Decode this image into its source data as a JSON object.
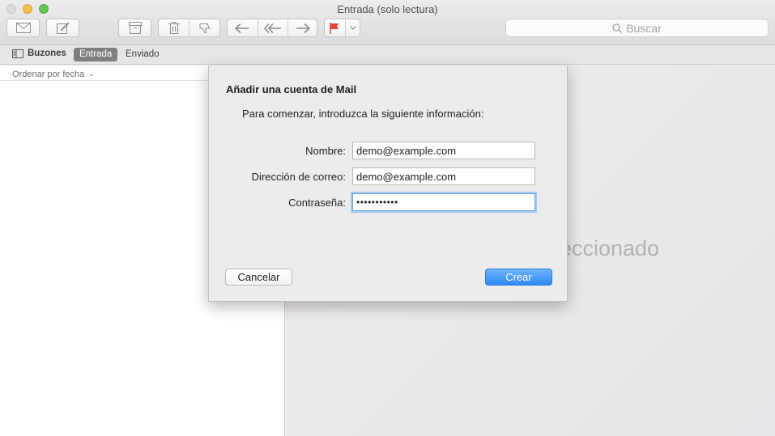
{
  "window": {
    "title": "Entrada (solo lectura)"
  },
  "toolbar": {
    "buttons": [
      {
        "name": "get-mail",
        "icon": "envelope-icon"
      },
      {
        "name": "compose",
        "icon": "compose-icon"
      },
      {
        "name": "archive",
        "icon": "archive-icon"
      },
      {
        "name": "delete",
        "icon": "trash-icon"
      },
      {
        "name": "junk",
        "icon": "thumbs-down-icon"
      },
      {
        "name": "reply",
        "icon": "reply-icon"
      },
      {
        "name": "reply-all",
        "icon": "reply-all-icon"
      },
      {
        "name": "forward",
        "icon": "forward-icon"
      },
      {
        "name": "flag",
        "icon": "flag-icon"
      },
      {
        "name": "flag-menu",
        "icon": "chevron-down-icon"
      }
    ],
    "search_placeholder": "Buscar"
  },
  "favorites": {
    "mailboxes_label": "Buzones",
    "inbox_label": "Entrada",
    "sent_label": "Enviado"
  },
  "list": {
    "sort_label": "Ordenar por fecha"
  },
  "viewer": {
    "message": "eleccionado"
  },
  "dialog": {
    "title": "Añadir una cuenta de Mail",
    "subtitle": "Para comenzar, introduzca la siguiente información:",
    "fields": {
      "name_label": "Nombre:",
      "name_value": "demo@example.com",
      "email_label": "Dirección de correo:",
      "email_value": "demo@example.com",
      "password_label": "Contraseña:",
      "password_value": "•••••••••••"
    },
    "cancel_label": "Cancelar",
    "create_label": "Crear"
  },
  "colors": {
    "accent": "#2f88f6",
    "flag": "#e0443a"
  }
}
